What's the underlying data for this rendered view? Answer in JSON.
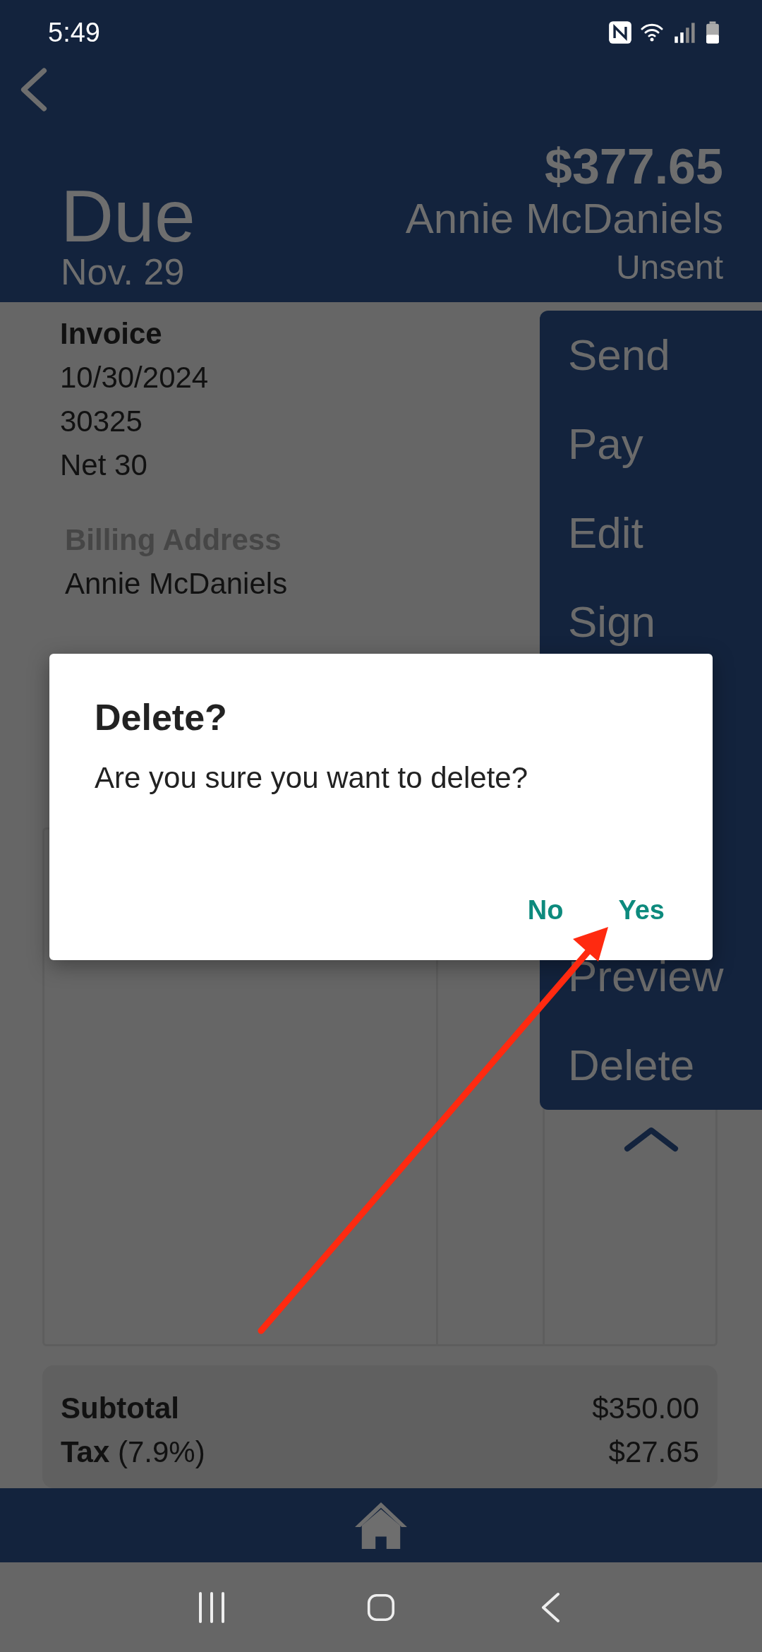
{
  "status_bar": {
    "time": "5:49"
  },
  "header": {
    "due_label": "Due",
    "due_date": "Nov. 29",
    "amount": "$377.65",
    "customer": "Annie McDaniels",
    "status": "Unsent"
  },
  "invoice": {
    "title": "Invoice",
    "lines": [
      "10/30/2024",
      "30325",
      "Net 30"
    ],
    "billing_label": "Billing Address",
    "billing_name": "Annie McDaniels"
  },
  "menu": {
    "items_top": [
      "Send",
      "Pay",
      "Edit",
      "Sign"
    ],
    "items_bottom": [
      "Preview",
      "Delete"
    ],
    "expanded": true
  },
  "totals": [
    {
      "label": "Subtotal",
      "value": "$350.00"
    },
    {
      "label": "Tax",
      "note": "(7.9%)",
      "value": "$27.65"
    }
  ],
  "dialog": {
    "title": "Delete?",
    "message": "Are you sure you want to delete?",
    "buttons": [
      "No",
      "Yes"
    ]
  }
}
